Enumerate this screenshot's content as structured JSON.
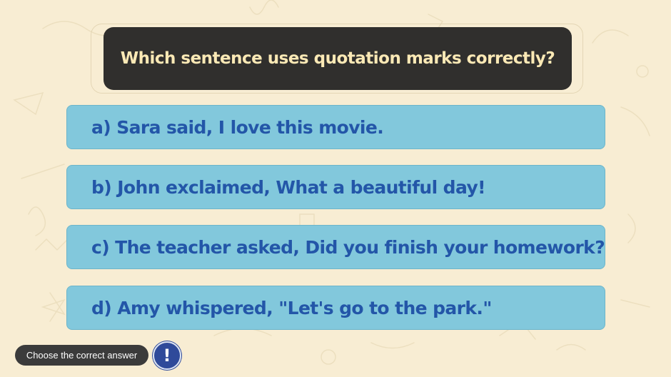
{
  "question": {
    "text": "Which sentence uses quotation marks correctly?"
  },
  "options": [
    {
      "label": "a) Sara said, I love this movie."
    },
    {
      "label": "b) John exclaimed, What a beautiful day!"
    },
    {
      "label": "c) The teacher asked, Did you finish your homework?"
    },
    {
      "label": "d) Amy whispered, \"Let's go to the park.\""
    }
  ],
  "footer": {
    "hint": "Choose the correct answer",
    "alert_glyph": "!",
    "alert_icon": "exclamation-icon"
  },
  "colors": {
    "background": "#f8edd3",
    "question_bg": "#302f2d",
    "question_text": "#fbe9b5",
    "option_bg": "#82c8dc",
    "option_text": "#2356a8",
    "hint_bg": "#3b3b3b",
    "alert_bg": "#2f4a9a"
  }
}
